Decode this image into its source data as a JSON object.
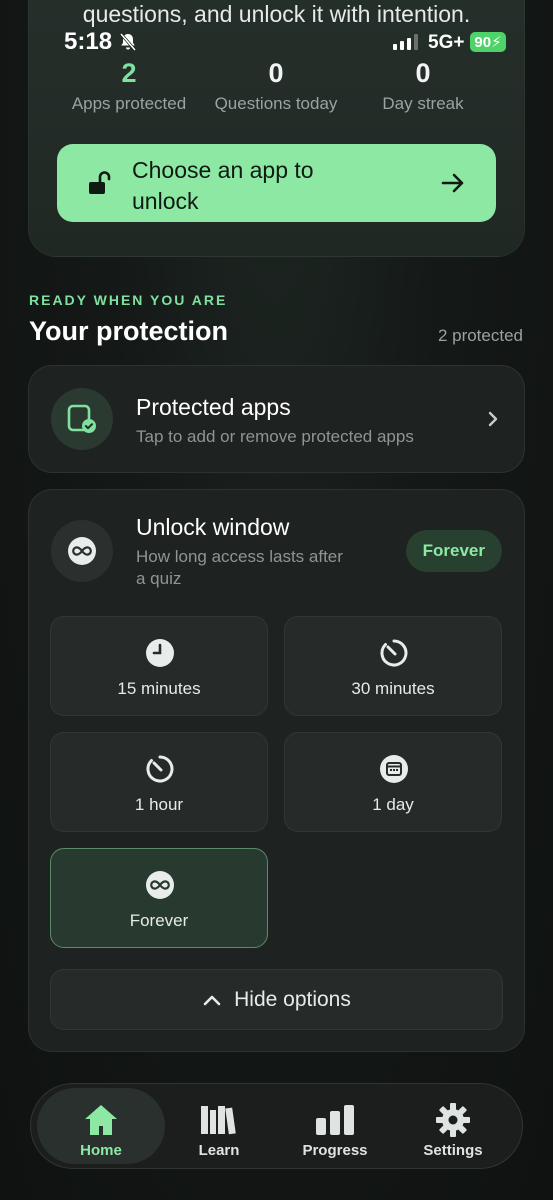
{
  "status_bar": {
    "time": "5:18",
    "network": "5G+",
    "battery": "90"
  },
  "hero": {
    "subtitle": "questions, and unlock it with intention.",
    "stats": [
      {
        "value": "2",
        "label": "Apps protected"
      },
      {
        "value": "0",
        "label": "Questions today"
      },
      {
        "value": "0",
        "label": "Day streak"
      }
    ],
    "cta_label": "Choose an app to unlock"
  },
  "section": {
    "eyebrow": "READY WHEN YOU ARE",
    "title": "Your protection",
    "count": "2 protected"
  },
  "protected_apps": {
    "title": "Protected apps",
    "description": "Tap to add or remove protected apps"
  },
  "unlock_window": {
    "title": "Unlock window",
    "description": "How long access lasts after a quiz",
    "current": "Forever",
    "options": [
      {
        "label": "15 minutes",
        "icon": "clock-icon"
      },
      {
        "label": "30 minutes",
        "icon": "timer-icon"
      },
      {
        "label": "1 hour",
        "icon": "timer-icon"
      },
      {
        "label": "1 day",
        "icon": "calendar-icon"
      },
      {
        "label": "Forever",
        "icon": "infinity-icon",
        "selected": true
      }
    ],
    "hide_label": "Hide options"
  },
  "tabs": [
    {
      "label": "Home",
      "icon": "home-icon",
      "active": true
    },
    {
      "label": "Learn",
      "icon": "books-icon"
    },
    {
      "label": "Progress",
      "icon": "bar-chart-icon"
    },
    {
      "label": "Settings",
      "icon": "gear-icon"
    }
  ],
  "colors": {
    "accent": "#8de8a4",
    "background": "#121614",
    "card": "#1e2220"
  }
}
